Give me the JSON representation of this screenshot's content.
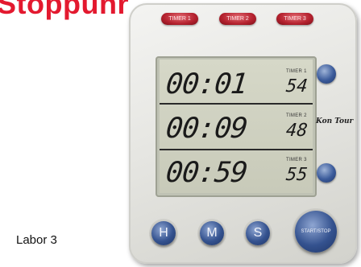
{
  "title": "Stoppuhr",
  "caption": "Labor 3",
  "device": {
    "timer_buttons": [
      "TIMER 1",
      "TIMER 2",
      "TIMER 3"
    ],
    "displays": [
      {
        "label": "TIMER 1",
        "main": "00:01",
        "seconds": "54"
      },
      {
        "label": "TIMER 2",
        "main": "00:09",
        "seconds": "48"
      },
      {
        "label": "TIMER 3",
        "main": "00:59",
        "seconds": "55"
      }
    ],
    "brand": "Kon Tour",
    "controls": {
      "hours": "H",
      "minutes": "M",
      "seconds": "S",
      "start_stop": "START/STOP"
    }
  }
}
